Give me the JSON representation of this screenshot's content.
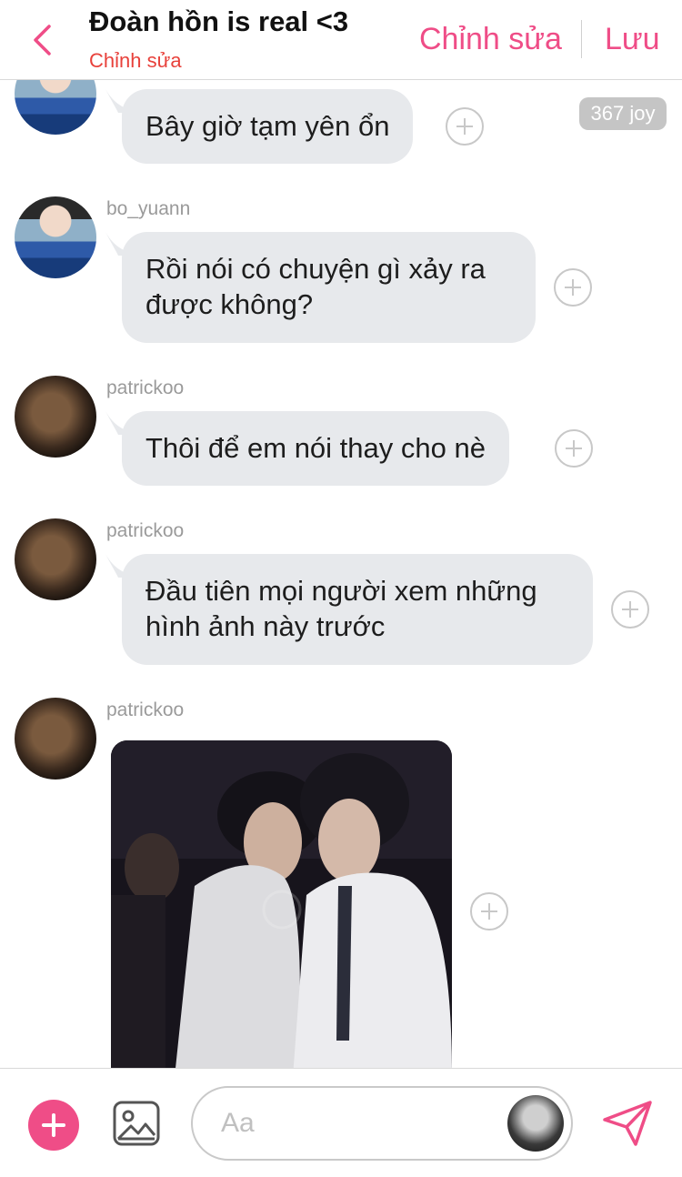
{
  "header": {
    "title": "Đoàn hồn is real <3",
    "subtitle": "Chỉnh sửa",
    "edit_label": "Chỉnh sửa",
    "save_label": "Lưu",
    "accent": "#ef4d87"
  },
  "messages": [
    {
      "author": "",
      "text": "Bây giờ tạm yên ổn",
      "badge": "367 joy"
    },
    {
      "author": "bo_yuann",
      "text": "Rồi nói có chuyện gì xảy ra được không?"
    },
    {
      "author": "patrickoo",
      "text": "Thôi để em nói thay cho nè"
    },
    {
      "author": "patrickoo",
      "text": "Đầu tiên mọi người xem những hình ảnh này trước"
    },
    {
      "author": "patrickoo",
      "image": "photo-attachment"
    }
  ],
  "composer": {
    "placeholder": "Aa"
  },
  "icons": {
    "back": "chevron-left-icon",
    "add_reaction": "plus-circle-icon",
    "add": "plus-icon",
    "gallery": "image-icon",
    "send": "send-icon"
  }
}
